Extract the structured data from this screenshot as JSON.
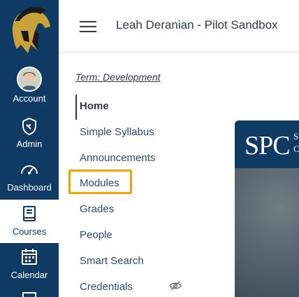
{
  "global_nav": {
    "items": [
      {
        "label": "Account",
        "icon": "avatar"
      },
      {
        "label": "Admin",
        "icon": "shield-icon"
      },
      {
        "label": "Dashboard",
        "icon": "dashboard-icon"
      },
      {
        "label": "Courses",
        "icon": "book-icon"
      },
      {
        "label": "Calendar",
        "icon": "calendar-icon"
      }
    ],
    "active": "Courses"
  },
  "header": {
    "course_title": "Leah Deranian - Pilot Sandbox"
  },
  "course_nav": {
    "term": "Term: Development",
    "items": [
      {
        "label": "Home"
      },
      {
        "label": "Simple Syllabus"
      },
      {
        "label": "Announcements"
      },
      {
        "label": "Modules"
      },
      {
        "label": "Grades"
      },
      {
        "label": "People"
      },
      {
        "label": "Smart Search"
      },
      {
        "label": "Credentials"
      }
    ],
    "selected": "Home",
    "focused": "Modules"
  },
  "banner": {
    "logo_text": "SPC",
    "logo_sub_top": "S",
    "logo_sub_bottom": "C"
  },
  "colors": {
    "nav_bg": "#0e3a64",
    "focus_ring": "#f0a500",
    "link": "#2b4a6f"
  }
}
